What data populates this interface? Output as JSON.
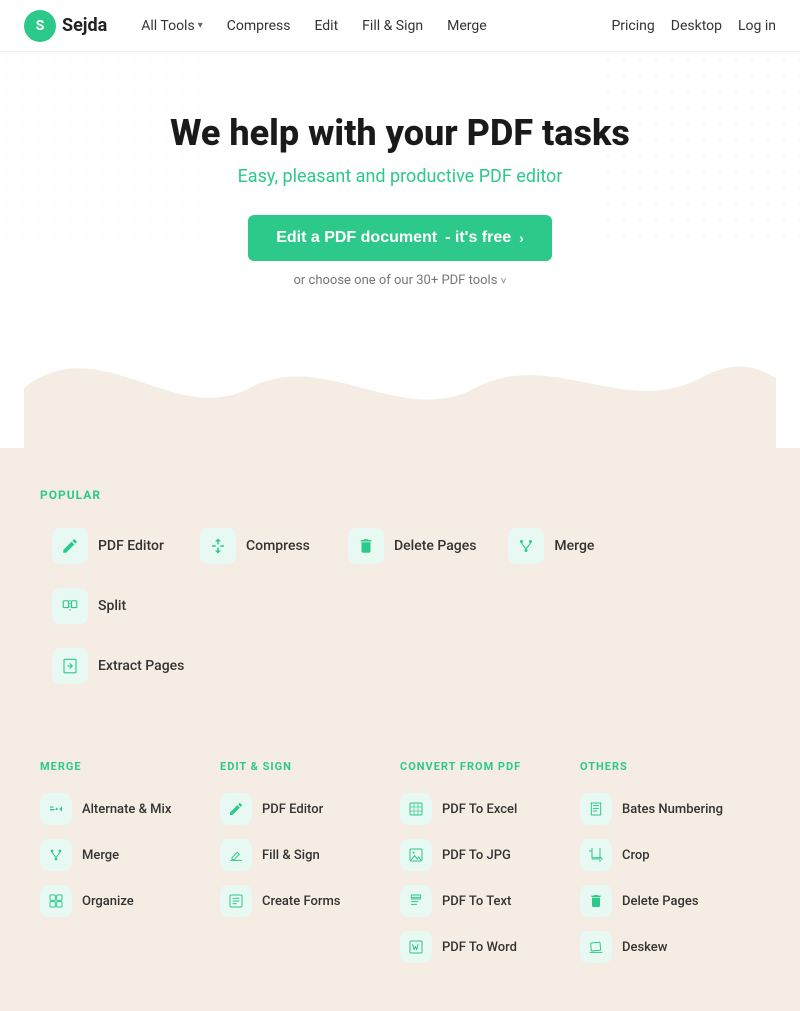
{
  "header": {
    "logo_letter": "S",
    "logo_name": "Sejda",
    "nav": [
      {
        "label": "All Tools",
        "has_chevron": true
      },
      {
        "label": "Compress"
      },
      {
        "label": "Edit"
      },
      {
        "label": "Fill & Sign"
      },
      {
        "label": "Merge"
      }
    ],
    "right_links": [
      {
        "label": "Pricing"
      },
      {
        "label": "Desktop"
      },
      {
        "label": "Log in"
      }
    ]
  },
  "hero": {
    "headline": "We help with your PDF tasks",
    "subtitle": "Easy, pleasant and productive PDF editor",
    "cta_main": "Edit a PDF document",
    "cta_suffix": " - it's free",
    "cta_sub": "or choose one of our 30+ PDF tools"
  },
  "popular": {
    "section_label": "POPULAR",
    "tools": [
      {
        "label": "PDF Editor",
        "icon": "edit"
      },
      {
        "label": "Compress",
        "icon": "compress"
      },
      {
        "label": "Delete Pages",
        "icon": "delete"
      },
      {
        "label": "Merge",
        "icon": "merge"
      },
      {
        "label": "Split",
        "icon": "split"
      },
      {
        "label": "Extract Pages",
        "icon": "extract"
      }
    ]
  },
  "categories": [
    {
      "label": "MERGE",
      "tools": [
        {
          "label": "Alternate & Mix",
          "icon": "alternate"
        },
        {
          "label": "Merge",
          "icon": "merge"
        },
        {
          "label": "Organize",
          "icon": "organize"
        }
      ]
    },
    {
      "label": "EDIT & SIGN",
      "tools": [
        {
          "label": "PDF Editor",
          "icon": "edit"
        },
        {
          "label": "Fill & Sign",
          "icon": "fillsign"
        },
        {
          "label": "Create Forms",
          "icon": "forms"
        }
      ]
    },
    {
      "label": "CONVERT FROM PDF",
      "tools": [
        {
          "label": "PDF To Excel",
          "icon": "excel"
        },
        {
          "label": "PDF To JPG",
          "icon": "jpg"
        },
        {
          "label": "PDF To Text",
          "icon": "text"
        },
        {
          "label": "PDF To Word",
          "icon": "word"
        }
      ]
    },
    {
      "label": "OTHERS",
      "tools": [
        {
          "label": "Bates Numbering",
          "icon": "bates"
        },
        {
          "label": "Crop",
          "icon": "crop"
        },
        {
          "label": "Delete Pages",
          "icon": "delete"
        },
        {
          "label": "Deskew",
          "icon": "deskew"
        }
      ]
    }
  ]
}
